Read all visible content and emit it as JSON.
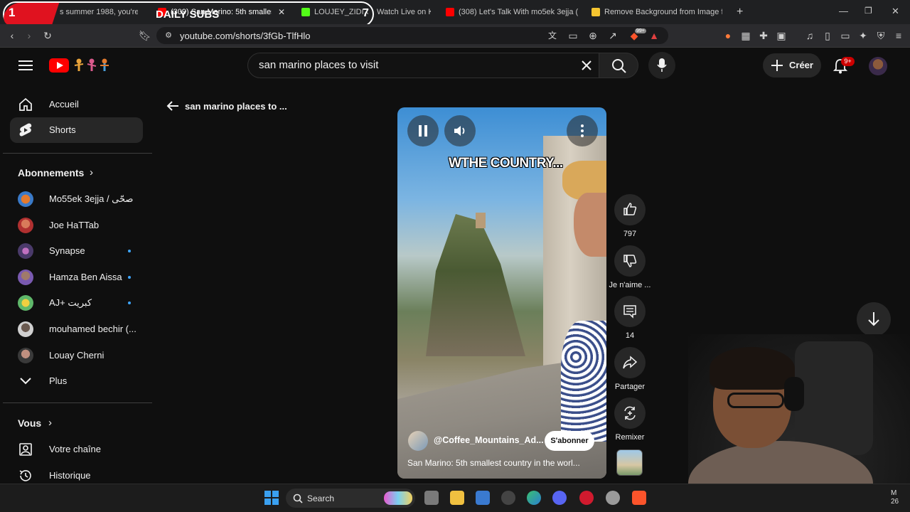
{
  "browser": {
    "tabs": [
      {
        "label": "s summer 1988, you're dr"
      },
      {
        "label": "(309) San Marino: 5th smalles"
      },
      {
        "label": "LOUJEY_ZIDI Chat"
      },
      {
        "label": "Watch Live on Ki"
      },
      {
        "label": "(308) Let's Talk With mo5ek 3ejja (a"
      },
      {
        "label": "Remove Background from Image for"
      }
    ],
    "url": "youtube.com/shorts/3fGb-TlfHlo",
    "extension_badge": "99+"
  },
  "stream_overlay": {
    "title": "DAILY SUBS",
    "left_count": "1",
    "right_count": "7"
  },
  "masthead": {
    "search_value": "san marino places to visit",
    "create_label": "Créer",
    "notification_count": "9+"
  },
  "sidebar": {
    "items": [
      {
        "label": "Accueil"
      },
      {
        "label": "Shorts"
      }
    ],
    "subscriptions_header": "Abonnements",
    "subscriptions": [
      {
        "label": "Mo55ek 3ejja / صحّى",
        "color": "#3a7ac8"
      },
      {
        "label": "Joe HaTTab",
        "color": "#b03030"
      },
      {
        "label": "Synapse",
        "color": "#6a4a8a"
      },
      {
        "label": "Hamza Ben Aissa",
        "color": "#7a5ab0"
      },
      {
        "label": "AJ+ كبريت",
        "color": "#5fb86a"
      },
      {
        "label": "mouhamed bechir (...",
        "color": "#d0d0d0"
      },
      {
        "label": "Louay Cherni",
        "color": "#8a6a5a"
      }
    ],
    "more_label": "Plus",
    "you_header": "Vous",
    "you_items": [
      {
        "label": "Votre chaîne"
      },
      {
        "label": "Historique"
      }
    ]
  },
  "short": {
    "back_title": "san marino places to ...",
    "caption_overlay": "WTHE COUNTRY...",
    "channel": "@Coffee_Mountains_Ad...",
    "subscribe_label": "S'abonner",
    "title": "San Marino: 5th smallest country in the worl..."
  },
  "actions": {
    "like_count": "797",
    "dislike_label": "Je n'aime ...",
    "comment_count": "14",
    "share_label": "Partager",
    "remix_label": "Remixer"
  },
  "taskbar": {
    "search_label": "Search",
    "clock_tail_1": "M",
    "clock_tail_2": "26"
  }
}
